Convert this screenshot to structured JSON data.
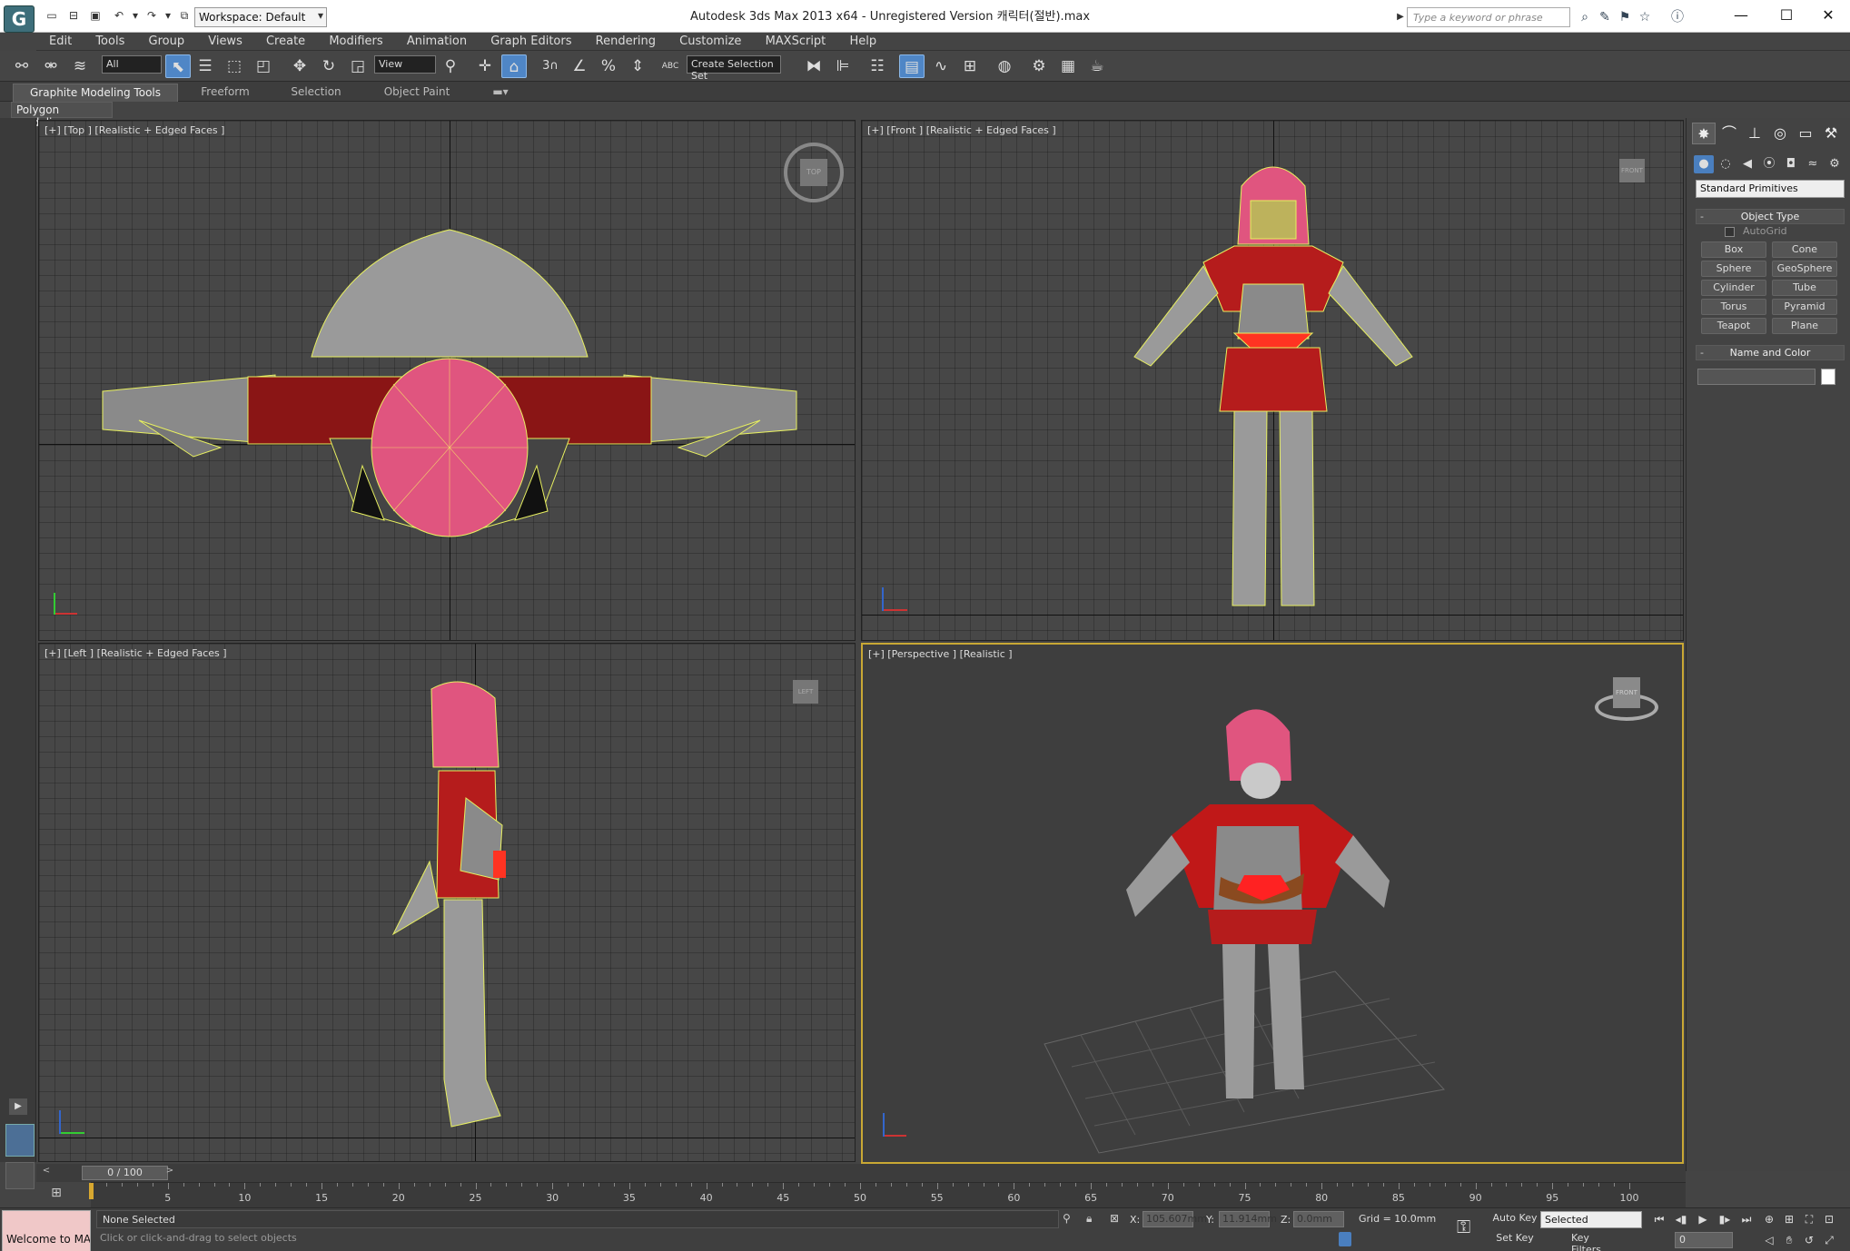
{
  "titlebar": {
    "app_title": "Autodesk 3ds Max  2013 x64  - Unregistered Version      캐릭터(절반).max",
    "workspace": "Workspace: Default",
    "search_placeholder": "Type a keyword or phrase",
    "app_logo": "G"
  },
  "menu": [
    "Edit",
    "Tools",
    "Group",
    "Views",
    "Create",
    "Modifiers",
    "Animation",
    "Graph Editors",
    "Rendering",
    "Customize",
    "MAXScript",
    "Help"
  ],
  "toolbar": {
    "selection_filter": "All",
    "ref_coord": "View",
    "named_selection": "Create Selection Set",
    "snap_3": "3",
    "abc_label": "ABC"
  },
  "ribbon": {
    "tabs": [
      "Graphite Modeling Tools",
      "Freeform",
      "Selection",
      "Object Paint"
    ],
    "active_tab": "Graphite Modeling Tools",
    "sub_panel": "Polygon Modeling"
  },
  "viewports": {
    "top": {
      "label": "[+] [Top ] [Realistic + Edged Faces ]",
      "cube_face": "TOP"
    },
    "front": {
      "label": "[+] [Front ] [Realistic + Edged Faces ]",
      "cube_face": "FRONT"
    },
    "left": {
      "label": "[+] [Left ] [Realistic + Edged Faces ]",
      "cube_face": "LEFT"
    },
    "perspective": {
      "label": "[+] [Perspective ] [Realistic ]",
      "cube_face": "FRONT"
    }
  },
  "command_panel": {
    "category": "Standard Primitives",
    "object_type_title": "Object Type",
    "autogrid": "AutoGrid",
    "primitives": [
      "Box",
      "Cone",
      "Sphere",
      "GeoSphere",
      "Cylinder",
      "Tube",
      "Torus",
      "Pyramid",
      "Teapot",
      "Plane"
    ],
    "name_color_title": "Name and Color",
    "swatch_color": "#ffffff"
  },
  "timeline": {
    "frame_display": "0 / 100",
    "current_frame": 0,
    "total_frames": 100,
    "ticks": [
      5,
      10,
      15,
      20,
      25,
      30,
      35,
      40,
      45,
      50,
      55,
      60,
      65,
      70,
      75,
      80,
      85,
      90,
      95,
      100
    ]
  },
  "statusbar": {
    "maxscript": "Welcome to MAXScript.",
    "selection_status": "None Selected",
    "prompt": "Click or click-and-drag to select objects",
    "x_label": "X:",
    "x_value": "105.607mm",
    "y_label": "Y:",
    "y_value": "11.914mm",
    "z_label": "Z:",
    "z_value": "0.0mm",
    "grid": "Grid = 10.0mm",
    "auto_key": "Auto Key",
    "set_key": "Set Key",
    "key_mode": "Selected",
    "key_filters": "Key Filters...",
    "frame_field": "0"
  },
  "colors": {
    "viewport_bg": "#474747",
    "active_viewport_border": "#c9a834",
    "helmet": "#e0557f",
    "armor_red": "#b51c1c",
    "armor_gray": "#9a9a9a",
    "wire": "#e8f060"
  }
}
